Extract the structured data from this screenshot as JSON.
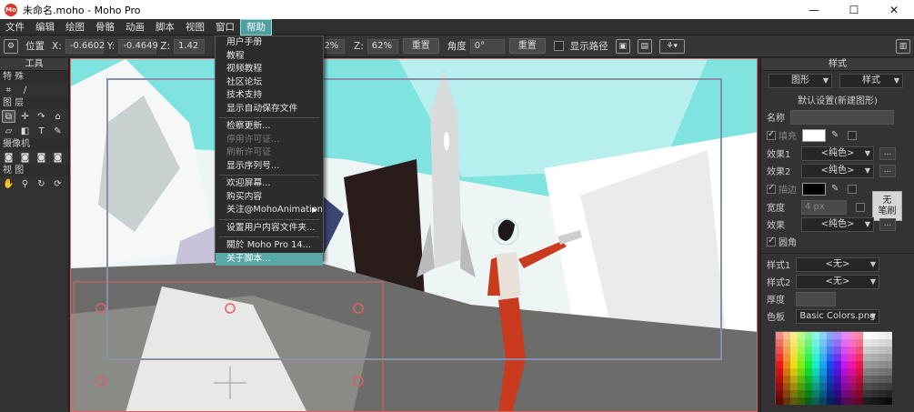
{
  "window": {
    "logo_text": "Mo",
    "title": "未命名.moho - Moho Pro",
    "minimize_glyph": "—",
    "maximize_glyph": "☐",
    "close_glyph": "✕"
  },
  "menubar": [
    "文件",
    "编辑",
    "绘图",
    "骨骼",
    "动画",
    "脚本",
    "视图",
    "窗口",
    "帮助"
  ],
  "toolbar": {
    "position_label": "位置",
    "x_label": "X:",
    "x_value": "-0.6602",
    "y_label": "Y:",
    "y_value": "-0.4649",
    "z_label": "Z:",
    "z_value": "1.42",
    "scale_value": "62%",
    "z2_label": "Z:",
    "z2_value": "62%",
    "reset1": "重置",
    "angle_label": "角度",
    "angle_value": "0°",
    "reset2": "重置",
    "show_path_label": "显示路径"
  },
  "help_menu": {
    "items": [
      {
        "label": "用户手册",
        "state": "normal"
      },
      {
        "label": "教程",
        "state": "normal"
      },
      {
        "label": "视频教程",
        "state": "normal"
      },
      {
        "label": "社区论坛",
        "state": "normal"
      },
      {
        "label": "技术支持",
        "state": "normal"
      },
      {
        "label": "显示自动保存文件",
        "state": "normal",
        "sep_after": true
      },
      {
        "label": "检察更新...",
        "state": "normal"
      },
      {
        "label": "停用许可证...",
        "state": "disabled"
      },
      {
        "label": "刷新许可证",
        "state": "disabled"
      },
      {
        "label": "显示序列号...",
        "state": "normal",
        "sep_after": true
      },
      {
        "label": "欢迎屏幕...",
        "state": "normal"
      },
      {
        "label": "购买内容",
        "state": "normal"
      },
      {
        "label": "关注@MohoAnimation",
        "state": "normal",
        "submenu": true,
        "sep_after": true
      },
      {
        "label": "设置用户内容文件夹...",
        "state": "normal",
        "sep_after": true
      },
      {
        "label": "關於 Moho Pro 14...",
        "state": "normal"
      },
      {
        "label": "关于脚本...",
        "state": "highlighted"
      }
    ]
  },
  "tools_panel": {
    "title": "工具",
    "sections": [
      "特 殊",
      "图 层",
      "摄像机",
      "视 图"
    ],
    "text_tool_glyph": "T"
  },
  "style_panel": {
    "title": "样式",
    "tab_shape": "图形",
    "tab_style": "样式",
    "default_label": "默认设置(新建图形)",
    "name_label": "名称",
    "fill_label": "填充",
    "effect1_label": "效果1",
    "effect1_value": "<纯色>",
    "effect2_label": "效果2",
    "effect2_value": "<纯色>",
    "stroke_label": "描边",
    "no_brush_line1": "无",
    "no_brush_line2": "笔刷",
    "width_label": "宽度",
    "width_value": "4 px",
    "effect_label": "效果",
    "effect_value": "<纯色>",
    "round_label": "圆角",
    "style1_label": "样式1",
    "style1_value": "<无>",
    "style2_label": "样式2",
    "style2_value": "<无>",
    "thickness_label": "厚度",
    "palette_label": "色板",
    "palette_value": "Basic Colors.png",
    "more_glyph": "..."
  },
  "colors": {
    "accent": "#5aa8a8",
    "selection_frame": "#e06060",
    "sky": "#7ee0e0"
  }
}
